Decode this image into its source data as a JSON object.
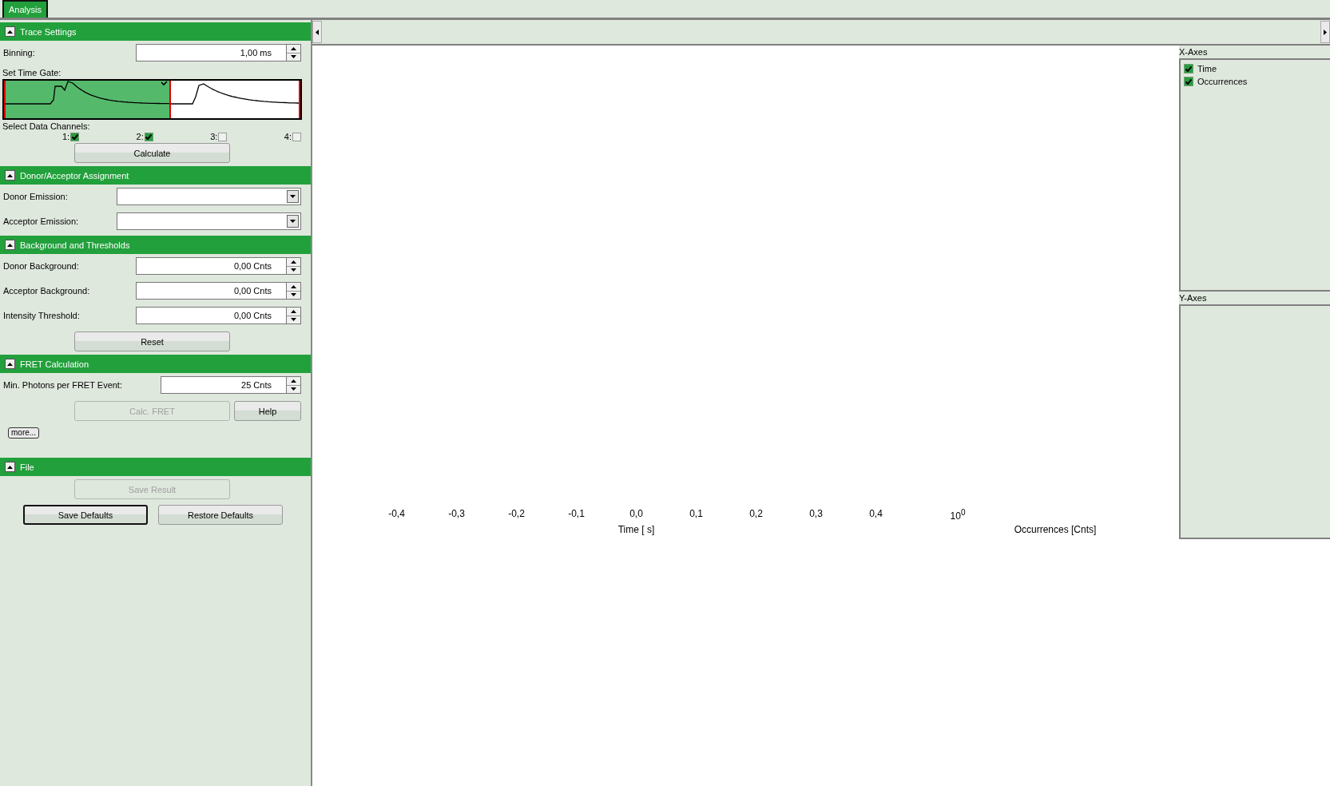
{
  "tabs": [
    {
      "label": "Analysis",
      "selected": true
    }
  ],
  "sections": [
    {
      "title": "Trace Settings",
      "expanded": true,
      "rows": [
        {
          "kind": "spin",
          "label": "Binning:",
          "value": "1,00 ms"
        },
        {
          "kind": "gate",
          "label": "Set Time Gate:",
          "level": 0.56
        },
        {
          "kind": "channels",
          "label": "Select Data Channels:",
          "channels": [
            {
              "label": "1:",
              "checked": true
            },
            {
              "label": "2:",
              "checked": true
            },
            {
              "label": "3:",
              "checked": false
            },
            {
              "label": "4:",
              "checked": false
            }
          ]
        },
        {
          "kind": "buttons",
          "buttons": [
            {
              "label": "Calculate",
              "disabled": false,
              "focused": false
            }
          ]
        }
      ]
    },
    {
      "title": "Donor/Acceptor Assignment",
      "expanded": true,
      "rows": [
        {
          "kind": "dropdown",
          "label": "Donor Emission:"
        },
        {
          "kind": "dropdown",
          "label": "Acceptor Emission:"
        }
      ]
    },
    {
      "title": "Background and Thresholds",
      "expanded": true,
      "rows": [
        {
          "kind": "spin",
          "label": "Donor Background:",
          "value": "0,00 Cnts"
        },
        {
          "kind": "spin",
          "label": "Acceptor Background:",
          "value": "0,00 Cnts"
        },
        {
          "kind": "spin",
          "label": "Intensity Threshold:",
          "value": "0,00 Cnts"
        },
        {
          "kind": "buttons",
          "buttons": [
            {
              "label": "Reset",
              "disabled": false,
              "focused": false
            }
          ]
        }
      ]
    },
    {
      "title": "FRET Calculation",
      "expanded": true,
      "rows": [
        {
          "kind": "spin_wide",
          "label": "Min. Photons per FRET Event:",
          "value": "25 Cnts"
        },
        {
          "kind": "buttons",
          "buttons": [
            {
              "label": "Calc. FRET",
              "disabled": true,
              "focused": false
            },
            {
              "label": "Help",
              "disabled": false,
              "focused": false
            }
          ]
        },
        {
          "kind": "small_button",
          "label": "more..."
        }
      ]
    },
    {
      "title": "File",
      "expanded": true,
      "rows": [
        {
          "kind": "buttons",
          "buttons": [
            {
              "label": "Save Result",
              "disabled": true,
              "focused": false
            }
          ]
        },
        {
          "kind": "button_pair",
          "buttons": [
            {
              "label": "Save Defaults",
              "disabled": false,
              "focused": true
            },
            {
              "label": "Restore Defaults",
              "disabled": false,
              "focused": false
            }
          ]
        }
      ]
    }
  ],
  "plot": {
    "time_ticks": [
      "-0,4",
      "-0,3",
      "-0,2",
      "-0,1",
      "0,0",
      "0,1",
      "0,2",
      "0,3",
      "0,4"
    ],
    "time_title": "Time [ s]",
    "occurrence_tick": "10$^{0}$",
    "occurrence_title": "Occurrences [Cnts]"
  },
  "x_axes": {
    "title": "X-Axes",
    "items": [
      {
        "label": "Time",
        "checked": true
      },
      {
        "label": "Occurrences",
        "checked": true
      }
    ]
  },
  "y_axes": {
    "title": "Y-Axes"
  }
}
